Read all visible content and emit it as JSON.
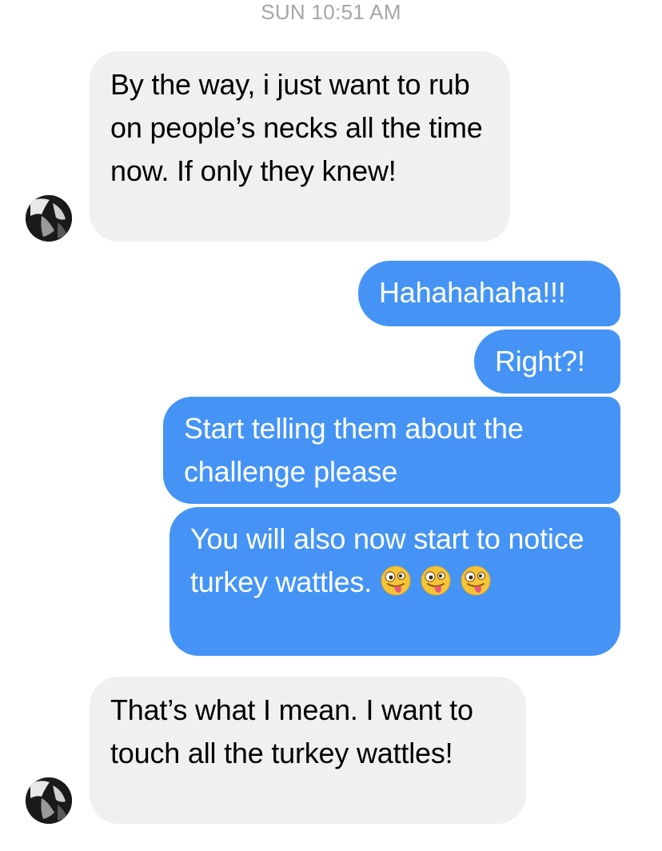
{
  "header": {
    "timestamp": "SUN 10:51 AM"
  },
  "messages": [
    {
      "sender": "contact",
      "text": "By the way, i just want to rub on people’s necks all the time now. If only they knew!"
    },
    {
      "sender": "me",
      "text": "Hahahahaha!!!"
    },
    {
      "sender": "me",
      "text": "Right?!"
    },
    {
      "sender": "me",
      "text": "Start telling them about the challenge please"
    },
    {
      "sender": "me",
      "text": "You will also now start to notice turkey wattles.",
      "emoji": [
        "zany-face",
        "zany-face",
        "zany-face"
      ]
    },
    {
      "sender": "contact",
      "text": "That’s what I mean. I want to touch all the turkey wattles!"
    }
  ],
  "colors": {
    "incoming_bubble": "#f0f0f0",
    "outgoing_bubble": "#4594f5",
    "timestamp": "#a5a5a9"
  },
  "icons": {
    "avatar": "contact-avatar",
    "emoji": "zany-face-emoji"
  }
}
